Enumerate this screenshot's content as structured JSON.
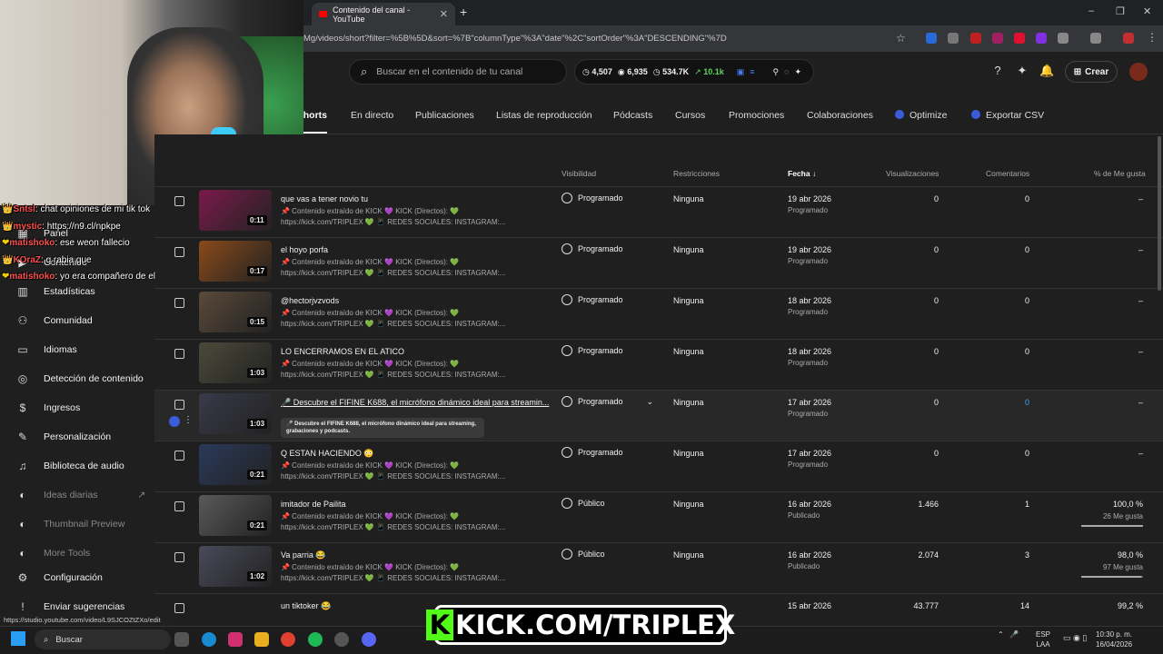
{
  "browser": {
    "tab_title": "Contenido del canal - YouTube",
    "url": "Mg/videos/short?filter=%5B%5D&sort=%7B\"columnType\"%3A\"date\"%2C\"sortOrder\"%3A\"DESCENDING\"%7D",
    "status_url": "https://studio.youtube.com/video/L9SJCOZtZXo/edit"
  },
  "header": {
    "search_placeholder": "Buscar en el contenido de tu canal",
    "stats": [
      "4,507",
      "6,935",
      "534.7K",
      "10.1k"
    ],
    "create_label": "Crear"
  },
  "tabs": [
    "Shorts",
    "En directo",
    "Publicaciones",
    "Listas de reproducción",
    "Pódcasts",
    "Cursos",
    "Promociones",
    "Colaboraciones",
    "Optimize",
    "Exportar CSV"
  ],
  "columns": {
    "visibility": "Visibilidad",
    "restrictions": "Restricciones",
    "date": "Fecha",
    "views": "Visualizaciones",
    "comments": "Comentarios",
    "likes": "% de Me gusta"
  },
  "sidebar": [
    "Panel",
    "Contenido",
    "Estadísticas",
    "Comunidad",
    "Idiomas",
    "Detección de contenido",
    "Ingresos",
    "Personalización",
    "Biblioteca de audio",
    "Ideas diarias",
    "Thumbnail Preview",
    "More Tools",
    "Configuración",
    "Enviar sugerencias"
  ],
  "rows": [
    {
      "title": "que vas a tener novio tu",
      "desc1": "📌 Contenido extraído de KICK 💜 KICK (Directos): 💚",
      "desc2": "https://kick.com/TRIPLEX 💚 📱 REDES SOCIALES: INSTAGRAM:...",
      "duration": "0:11",
      "visibility": "Programado",
      "restriction": "Ninguna",
      "date": "19 abr 2026",
      "date_sub": "Programado",
      "views": "0",
      "comments": "0",
      "likes": "–",
      "likes_sub": ""
    },
    {
      "title": "el hoyo porfa",
      "desc1": "📌 Contenido extraído de KICK 💜 KICK (Directos): 💚",
      "desc2": "https://kick.com/TRIPLEX 💚 📱 REDES SOCIALES: INSTAGRAM:...",
      "duration": "0:17",
      "visibility": "Programado",
      "restriction": "Ninguna",
      "date": "19 abr 2026",
      "date_sub": "Programado",
      "views": "0",
      "comments": "0",
      "likes": "–",
      "likes_sub": ""
    },
    {
      "title": "@hectorjvzvods",
      "desc1": "📌 Contenido extraído de KICK 💜 KICK (Directos): 💚",
      "desc2": "https://kick.com/TRIPLEX 💚 📱 REDES SOCIALES: INSTAGRAM:...",
      "duration": "0:15",
      "visibility": "Programado",
      "restriction": "Ninguna",
      "date": "18 abr 2026",
      "date_sub": "Programado",
      "views": "0",
      "comments": "0",
      "likes": "–",
      "likes_sub": ""
    },
    {
      "title": "LO ENCERRAMOS EN EL ATICO",
      "desc1": "📌 Contenido extraído de KICK 💜 KICK (Directos): 💚",
      "desc2": "https://kick.com/TRIPLEX 💚 📱 REDES SOCIALES: INSTAGRAM:...",
      "duration": "1:03",
      "visibility": "Programado",
      "restriction": "Ninguna",
      "date": "18 abr 2026",
      "date_sub": "Programado",
      "views": "0",
      "comments": "0",
      "likes": "–",
      "likes_sub": ""
    },
    {
      "title": "🎤 Descubre el FIFINE K688, el micrófono dinámico ideal para streamin...",
      "tooltip": "🎤 Descubre el FIFINE K688, el micrófono dinámico ideal para streaming, grabaciones y podcasts.",
      "desc1": "",
      "desc2": "",
      "duration": "1:03",
      "visibility": "Programado",
      "restriction": "Ninguna",
      "date": "17 abr 2026",
      "date_sub": "Programado",
      "views": "0",
      "comments": "0",
      "likes": "–",
      "likes_sub": ""
    },
    {
      "title": "Q ESTAN HACIENDO 😳",
      "desc1": "📌 Contenido extraído de KICK 💜 KICK (Directos): 💚",
      "desc2": "https://kick.com/TRIPLEX 💚 📱 REDES SOCIALES: INSTAGRAM:...",
      "duration": "0:21",
      "visibility": "Programado",
      "restriction": "Ninguna",
      "date": "17 abr 2026",
      "date_sub": "Programado",
      "views": "0",
      "comments": "0",
      "likes": "–",
      "likes_sub": ""
    },
    {
      "title": "imitador de Pailita",
      "desc1": "📌 Contenido extraído de KICK 💜 KICK (Directos): 💚",
      "desc2": "https://kick.com/TRIPLEX 💚 📱 REDES SOCIALES: INSTAGRAM:...",
      "duration": "0:21",
      "visibility": "Público",
      "restriction": "Ninguna",
      "date": "16 abr 2026",
      "date_sub": "Publicado",
      "views": "1.466",
      "comments": "1",
      "likes": "100,0 %",
      "likes_sub": "26 Me gusta",
      "likes_ratio": 1.0
    },
    {
      "title": "Va parria 😂",
      "desc1": "📌 Contenido extraído de KICK 💜 KICK (Directos): 💚",
      "desc2": "https://kick.com/TRIPLEX 💚 📱 REDES SOCIALES: INSTAGRAM:...",
      "duration": "1:02",
      "visibility": "Público",
      "restriction": "Ninguna",
      "date": "16 abr 2026",
      "date_sub": "Publicado",
      "views": "2.074",
      "comments": "3",
      "likes": "98,0 %",
      "likes_sub": "97 Me gusta",
      "likes_ratio": 0.98
    },
    {
      "title": "un tiktoker 😂",
      "desc1": "",
      "desc2": "",
      "duration": "",
      "visibility": "",
      "restriction": "",
      "date": "15 abr 2026",
      "date_sub": "",
      "views": "43.777",
      "comments": "14",
      "likes": "99,2 %",
      "likes_sub": ""
    }
  ],
  "chat": [
    {
      "user": "Sntsl",
      "msg": ": chat opiniones de mi tik tok"
    },
    {
      "user": "mystic",
      "msg": ": https://n9.cl/npkpe"
    },
    {
      "user": "matishoko",
      "msg": ": ese weon fallecio"
    },
    {
      "user": "KOraZ",
      "msg": ": q rabia que"
    },
    {
      "user": "matishoko",
      "msg": ": yo era compañero de el"
    }
  ],
  "overlay": {
    "kick_text": "KICK.COM/TRIPLEX",
    "kick_k": "K"
  },
  "taskbar": {
    "search": "Buscar",
    "lang1": "ESP",
    "lang2": "LAA",
    "time": "10:30 p. m.",
    "date": "16/04/2026"
  }
}
